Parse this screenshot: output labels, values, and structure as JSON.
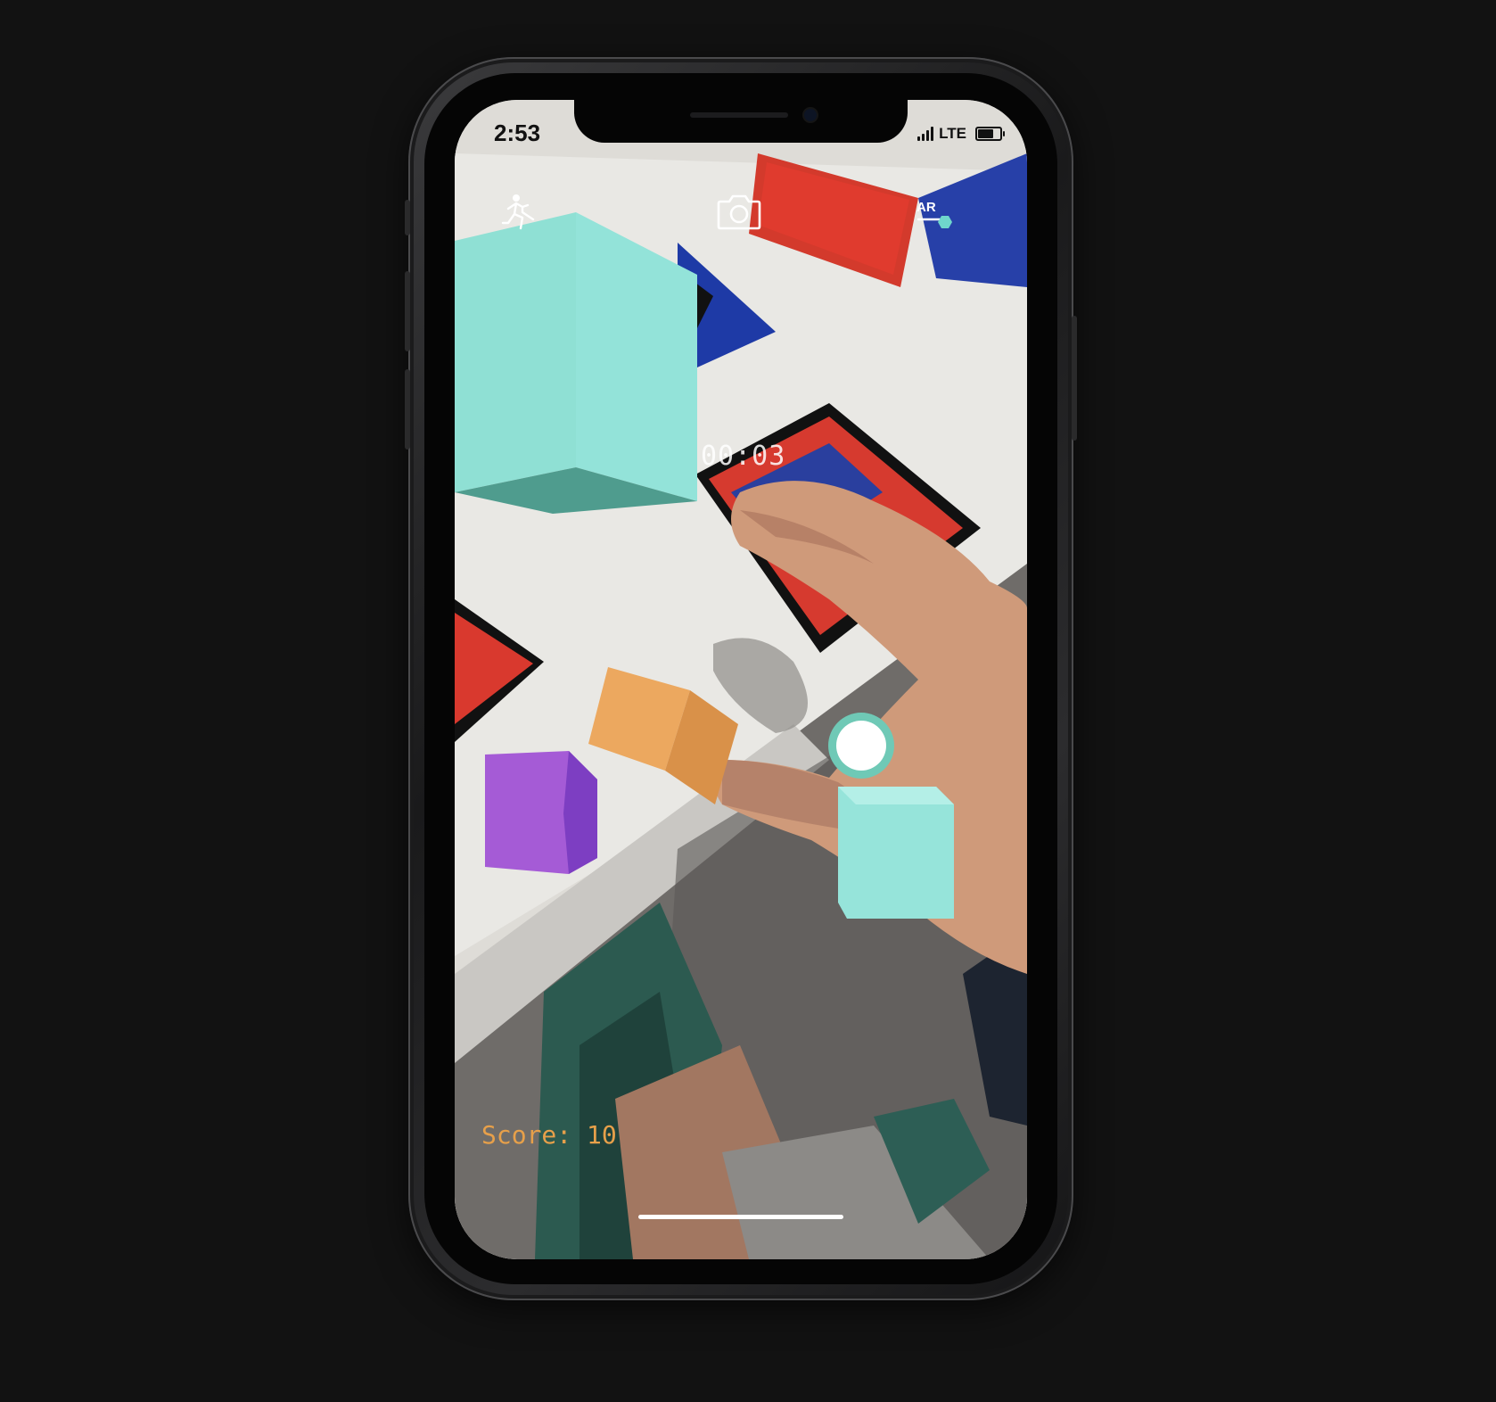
{
  "status_bar": {
    "time": "2:53",
    "network": "LTE",
    "signal_bars": 4,
    "battery_level": 0.85
  },
  "toolbar": {
    "left_icon": "running-person-icon",
    "center_icon": "camera-icon",
    "right_icon": "ar-toggle-icon",
    "ar_label": "AR"
  },
  "game": {
    "timer": "00:03",
    "score_text": "Score: 10",
    "reticle_icon": "aim-reticle-icon"
  },
  "cubes": [
    {
      "name": "cube-teal-large",
      "color": "#8fe0d4"
    },
    {
      "name": "cube-orange",
      "color": "#eca85f"
    },
    {
      "name": "cube-purple",
      "color": "#a55bd6"
    },
    {
      "name": "cube-teal-small",
      "color": "#96e4da"
    }
  ],
  "colors": {
    "accent_teal": "#6fc9b6",
    "score_orange": "#e7a04a"
  }
}
